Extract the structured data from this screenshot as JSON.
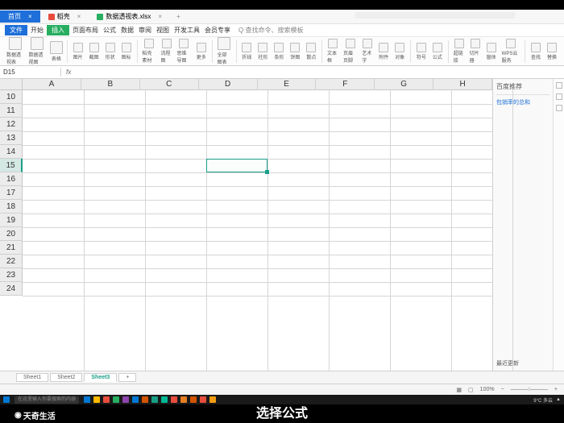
{
  "tabs": [
    {
      "label": "首页"
    },
    {
      "label": "稻壳"
    },
    {
      "label": "数据透视表.xlsx"
    }
  ],
  "menu": {
    "file": "文件",
    "items": [
      "开始",
      "插入",
      "页面布局",
      "公式",
      "数据",
      "审阅",
      "视图",
      "开发工具",
      "会员专享"
    ],
    "insert": "插入",
    "search": "Q 查找命令、搜索模板"
  },
  "ribbon_groups": [
    [
      "数据透视表",
      "数据透视图",
      "表格"
    ],
    [
      "图片",
      "截图",
      "形状",
      "图标"
    ],
    [
      "稻壳素材",
      "流程图",
      "思维导图",
      "更多"
    ],
    [
      "全部图表"
    ],
    [
      "折线",
      "柱形",
      "条形",
      "饼图",
      "散点"
    ],
    [
      "文本框",
      "页眉页脚",
      "艺术字",
      "附件",
      "对象"
    ],
    [
      "符号",
      "公式"
    ],
    [
      "超链接",
      "切片器",
      "窗体",
      "WPS云服务"
    ],
    [
      "查找",
      "替换"
    ]
  ],
  "namebox": "D15",
  "fx_label": "fx",
  "columns": [
    "A",
    "B",
    "C",
    "D",
    "E",
    "F",
    "G",
    "H"
  ],
  "rows": [
    "10",
    "11",
    "12",
    "13",
    "14",
    "15",
    "16",
    "17",
    "18",
    "19",
    "20",
    "21",
    "22",
    "23",
    "24"
  ],
  "selected_row": "15",
  "selection": {
    "col": 3,
    "row": 5
  },
  "sheet_tabs": [
    "Sheet1",
    "Sheet2",
    "Sheet3"
  ],
  "sheet_active": 2,
  "status": {
    "zoom": "100%"
  },
  "right_pane": {
    "title": "百度推荐",
    "link": "包销率的总和",
    "bottom": "最近更新"
  },
  "taskbar": {
    "search": "在这里输入你要搜索的内容",
    "weather": "9°C 多云",
    "apps_colors": [
      "#0078d4",
      "#ffb900",
      "#e74c3c",
      "#27ae60",
      "#8e44ad",
      "#0078d4",
      "#d35400",
      "#16a085",
      "#00b894",
      "#e74c3c",
      "#e67e22",
      "#d35400",
      "#e74c3c",
      "#f39c12"
    ]
  },
  "caption": "选择公式",
  "watermark": "天奇生活"
}
